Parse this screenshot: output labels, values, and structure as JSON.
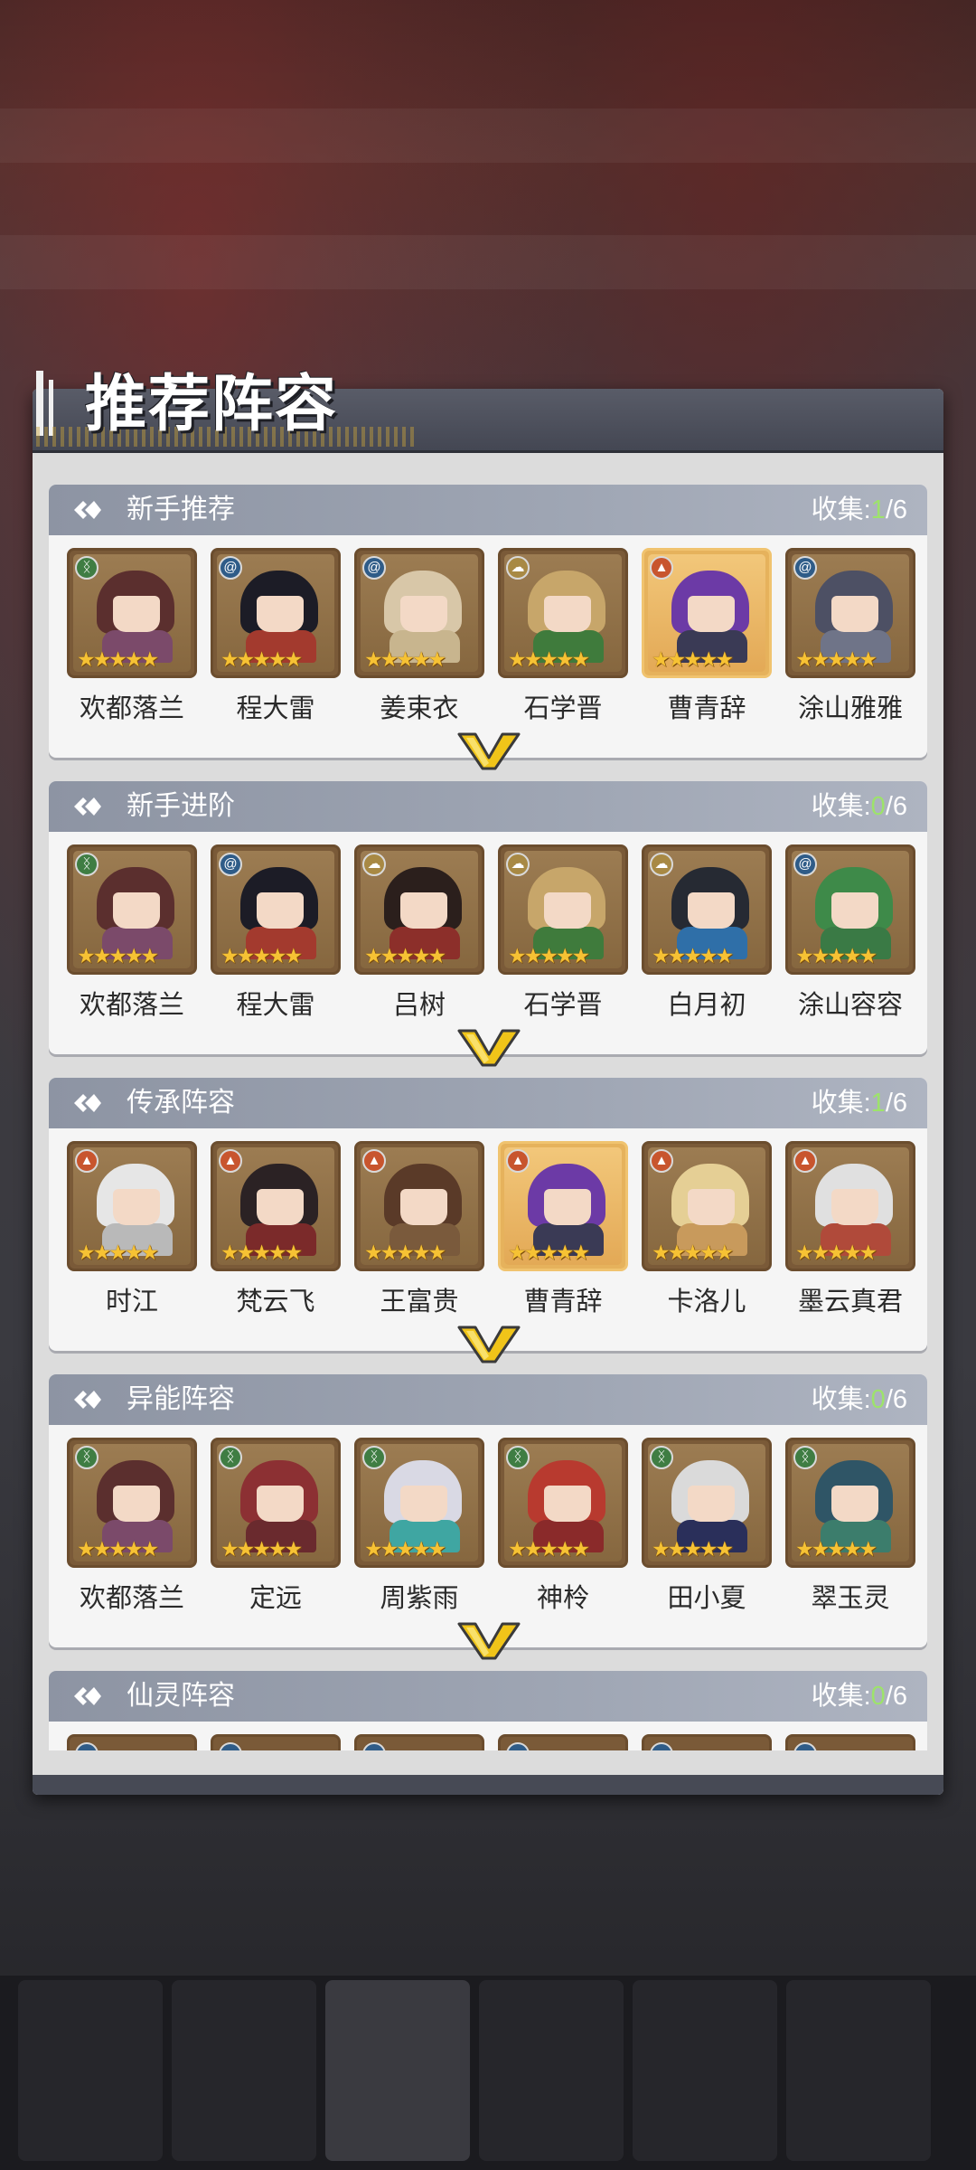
{
  "title": "推荐阵容",
  "sections": [
    {
      "title": "新手推荐",
      "collect_label": "收集:",
      "collect_got": "1",
      "collect_total": "/6",
      "heroes": [
        {
          "name": "欢都落兰",
          "badge": "green",
          "owned": false,
          "hair": "#5b2f2e",
          "cloth": "#7b4a6a"
        },
        {
          "name": "程大雷",
          "badge": "blue",
          "owned": false,
          "hair": "#1c1c26",
          "cloth": "#a33a2e"
        },
        {
          "name": "姜束衣",
          "badge": "blue",
          "owned": false,
          "hair": "#d8c7a8",
          "cloth": "#c8b58e"
        },
        {
          "name": "石学晋",
          "badge": "gold",
          "owned": false,
          "hair": "#c7a66a",
          "cloth": "#3f7b3c"
        },
        {
          "name": "曹青辞",
          "badge": "orange",
          "owned": true,
          "hair": "#6c3aa6",
          "cloth": "#3a3a55"
        },
        {
          "name": "涂山雅雅",
          "badge": "blue",
          "owned": false,
          "hair": "#4d5064",
          "cloth": "#6f7488"
        }
      ]
    },
    {
      "title": "新手进阶",
      "collect_label": "收集:",
      "collect_got": "0",
      "collect_total": "/6",
      "heroes": [
        {
          "name": "欢都落兰",
          "badge": "green",
          "owned": false,
          "hair": "#5b2f2e",
          "cloth": "#7b4a6a"
        },
        {
          "name": "程大雷",
          "badge": "blue",
          "owned": false,
          "hair": "#1c1c26",
          "cloth": "#a33a2e"
        },
        {
          "name": "吕树",
          "badge": "gold",
          "owned": false,
          "hair": "#2b1f1c",
          "cloth": "#8c2f2a"
        },
        {
          "name": "石学晋",
          "badge": "gold",
          "owned": false,
          "hair": "#c7a66a",
          "cloth": "#3f7b3c"
        },
        {
          "name": "白月初",
          "badge": "gold",
          "owned": false,
          "hair": "#262a33",
          "cloth": "#2f6fa8"
        },
        {
          "name": "涂山容容",
          "badge": "blue",
          "owned": false,
          "hair": "#3e8a49",
          "cloth": "#3a7a45"
        }
      ]
    },
    {
      "title": "传承阵容",
      "collect_label": "收集:",
      "collect_got": "1",
      "collect_total": "/6",
      "heroes": [
        {
          "name": "时江",
          "badge": "orange",
          "owned": false,
          "hair": "#e6e6e6",
          "cloth": "#b9b9b9"
        },
        {
          "name": "梵云飞",
          "badge": "orange",
          "owned": false,
          "hair": "#2b2224",
          "cloth": "#7b2a2a"
        },
        {
          "name": "王富贵",
          "badge": "orange",
          "owned": false,
          "hair": "#5a3a28",
          "cloth": "#7a5a3c"
        },
        {
          "name": "曹青辞",
          "badge": "orange",
          "owned": true,
          "hair": "#6c3aa6",
          "cloth": "#3a3a55"
        },
        {
          "name": "卡洛儿",
          "badge": "orange",
          "owned": false,
          "hair": "#e5cf95",
          "cloth": "#c89a5c"
        },
        {
          "name": "墨云真君",
          "badge": "orange",
          "owned": false,
          "hair": "#e0e0e0",
          "cloth": "#b04a3a"
        }
      ]
    },
    {
      "title": "异能阵容",
      "collect_label": "收集:",
      "collect_got": "0",
      "collect_total": "/6",
      "heroes": [
        {
          "name": "欢都落兰",
          "badge": "green",
          "owned": false,
          "hair": "#5b2f2e",
          "cloth": "#7b4a6a"
        },
        {
          "name": "定远",
          "badge": "green",
          "owned": false,
          "hair": "#8c3033",
          "cloth": "#6a2a2e"
        },
        {
          "name": "周紫雨",
          "badge": "green",
          "owned": false,
          "hair": "#d9d9e4",
          "cloth": "#3fa6a2"
        },
        {
          "name": "神柃",
          "badge": "green",
          "owned": false,
          "hair": "#b83a2f",
          "cloth": "#8a2a2a"
        },
        {
          "name": "田小夏",
          "badge": "green",
          "owned": false,
          "hair": "#dadada",
          "cloth": "#2a2f5a"
        },
        {
          "name": "翠玉灵",
          "badge": "green",
          "owned": false,
          "hair": "#2f5566",
          "cloth": "#3c7d6c"
        }
      ]
    },
    {
      "title": "仙灵阵容",
      "collect_label": "收集:",
      "collect_got": "0",
      "collect_total": "/6",
      "heroes": []
    }
  ],
  "colors": {
    "collect_got": "#9de36a",
    "panel_bg": "#dcdcdc",
    "section_header": "#9aa1af",
    "star": "#f6c234"
  },
  "icons": {
    "section": "diamond-arrow-icon",
    "expand": "chevron-down-icon",
    "badge_green": "dna-icon",
    "badge_blue": "swirl-icon",
    "badge_gold": "cloud-icon",
    "badge_orange": "flame-icon",
    "star": "star-icon"
  }
}
